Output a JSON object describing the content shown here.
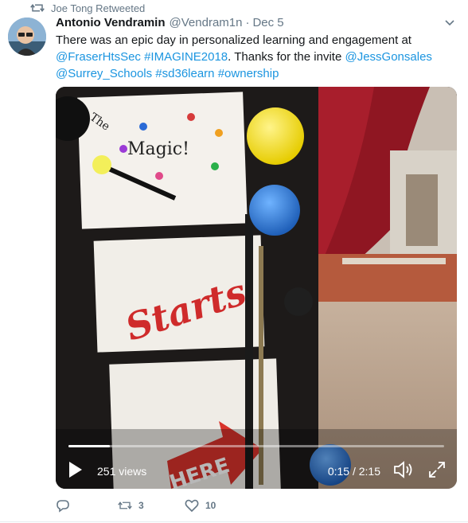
{
  "retweet": {
    "text": "Joe Tong Retweeted",
    "icon": "retweet-icon"
  },
  "author": {
    "name": "Antonio Vendramin",
    "handle": "@Vendram1n",
    "separator": "·",
    "date": "Dec 5"
  },
  "tweet": {
    "segments": [
      {
        "text": "There was an epic day in personalized learning and engagement at ",
        "link": false
      },
      {
        "text": "@FraserHtsSec",
        "link": true
      },
      {
        "text": " ",
        "link": false
      },
      {
        "text": "#IMAGINE2018",
        "link": true
      },
      {
        "text": ". Thanks for the invite ",
        "link": false
      },
      {
        "text": "@JessGonsales",
        "link": true
      },
      {
        "text": " ",
        "link": false
      },
      {
        "text": "@Surrey_Schools",
        "link": true
      },
      {
        "text": " ",
        "link": false
      },
      {
        "text": "#sd36learn",
        "link": true
      },
      {
        "text": " ",
        "link": false
      },
      {
        "text": "#ownership",
        "link": true
      }
    ]
  },
  "video": {
    "views": "251 views",
    "timecode": "0:15 / 2:15",
    "progress": 0.111,
    "sign_lines": [
      "The",
      "Magic!",
      "Starts",
      "HERE"
    ]
  },
  "actions": {
    "reply_count": "",
    "retweet_count": "3",
    "like_count": "10"
  },
  "colors": {
    "link": "#1b95e0",
    "secondary": "#657786",
    "text": "#14171a"
  }
}
